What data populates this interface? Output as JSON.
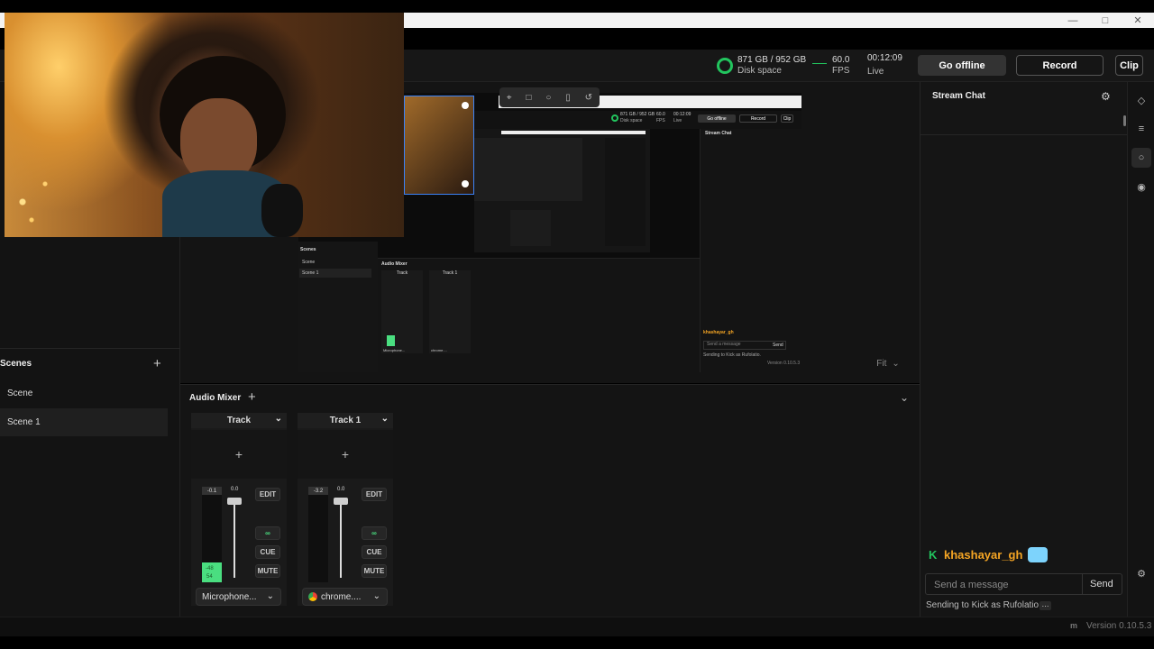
{
  "window": {
    "minimize_icon": "minimize-icon",
    "maximize_icon": "maximize-icon",
    "close_icon": "close-icon"
  },
  "stats": {
    "disk": "871 GB / 952 GB",
    "disk_label": "Disk space",
    "fps": "60.0",
    "fps_label": "FPS",
    "time": "00:12:09",
    "time_label": "Live",
    "disk_color": "#22c55e"
  },
  "actions": {
    "go_offline": "Go offline",
    "record": "Record",
    "clip": "Clip"
  },
  "preview": {
    "fit_label": "Fit",
    "toolbox_icons": [
      "crop-icon",
      "rectangle-icon",
      "circle-icon",
      "mobile-icon",
      "rotate-icon"
    ]
  },
  "scenes": {
    "title": "Scenes",
    "add_icon": "+",
    "items": [
      {
        "label": "Scene"
      },
      {
        "label": "Scene 1"
      }
    ]
  },
  "mixer": {
    "title": "Audio Mixer",
    "add_icon": "+",
    "tracks": [
      {
        "name": "Track",
        "peak": "-0.1",
        "gain": "0.0",
        "meter_low": "-48",
        "meter_low2": "54",
        "edit": "EDIT",
        "cue": "CUE",
        "mute": "MUTE",
        "source": "Microphone...",
        "level": 0.18
      },
      {
        "name": "Track 1",
        "peak": "-3.2",
        "gain": "0.0",
        "edit": "EDIT",
        "cue": "CUE",
        "mute": "MUTE",
        "source": "chrome....",
        "level": 0.0
      }
    ]
  },
  "chat": {
    "title": "Stream Chat",
    "username": "khashayar_gh",
    "username_color": "#f5a524",
    "input_placeholder": "Send a message",
    "send": "Send",
    "sending_as": "Sending to Kick as Rufolatio."
  },
  "footer": {
    "version": "Version 0.10.5.3"
  },
  "inner_preview": {
    "disk": "871 GB / 952 GB",
    "disk_label": "Disk space",
    "fps": "60.0",
    "fps_label": "FPS",
    "time": "00:12:09",
    "time_label": "Live",
    "go_offline": "Go offline",
    "record": "Record",
    "clip": "Clip",
    "chat_title": "Stream Chat",
    "scenes_title": "Scenes",
    "scene_a": "Scene",
    "scene_b": "Scene 1",
    "mixer_title": "Audio Mixer",
    "track_a": "Track",
    "track_b": "Track 1",
    "edit": "EDIT",
    "cue": "CUE",
    "mute": "MUTE",
    "src_a": "Microphone...",
    "src_b": "chrome....",
    "username": "khashayar_gh",
    "placeholder": "Send a message",
    "send": "Send",
    "sending_as": "Sending to Kick as Rufolatio.",
    "version": "Version 0.10.5.3",
    "fit": "Fit"
  }
}
